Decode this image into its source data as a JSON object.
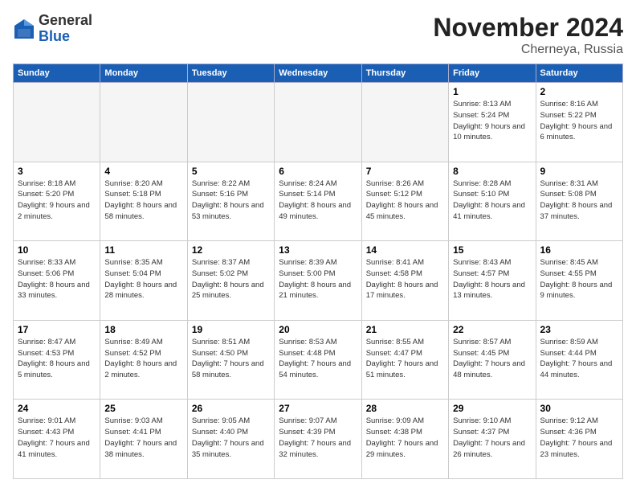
{
  "header": {
    "logo_general": "General",
    "logo_blue": "Blue",
    "month": "November 2024",
    "location": "Cherneya, Russia"
  },
  "days_of_week": [
    "Sunday",
    "Monday",
    "Tuesday",
    "Wednesday",
    "Thursday",
    "Friday",
    "Saturday"
  ],
  "weeks": [
    [
      {
        "day": "",
        "info": ""
      },
      {
        "day": "",
        "info": ""
      },
      {
        "day": "",
        "info": ""
      },
      {
        "day": "",
        "info": ""
      },
      {
        "day": "",
        "info": ""
      },
      {
        "day": "1",
        "info": "Sunrise: 8:13 AM\nSunset: 5:24 PM\nDaylight: 9 hours\nand 10 minutes."
      },
      {
        "day": "2",
        "info": "Sunrise: 8:16 AM\nSunset: 5:22 PM\nDaylight: 9 hours\nand 6 minutes."
      }
    ],
    [
      {
        "day": "3",
        "info": "Sunrise: 8:18 AM\nSunset: 5:20 PM\nDaylight: 9 hours\nand 2 minutes."
      },
      {
        "day": "4",
        "info": "Sunrise: 8:20 AM\nSunset: 5:18 PM\nDaylight: 8 hours\nand 58 minutes."
      },
      {
        "day": "5",
        "info": "Sunrise: 8:22 AM\nSunset: 5:16 PM\nDaylight: 8 hours\nand 53 minutes."
      },
      {
        "day": "6",
        "info": "Sunrise: 8:24 AM\nSunset: 5:14 PM\nDaylight: 8 hours\nand 49 minutes."
      },
      {
        "day": "7",
        "info": "Sunrise: 8:26 AM\nSunset: 5:12 PM\nDaylight: 8 hours\nand 45 minutes."
      },
      {
        "day": "8",
        "info": "Sunrise: 8:28 AM\nSunset: 5:10 PM\nDaylight: 8 hours\nand 41 minutes."
      },
      {
        "day": "9",
        "info": "Sunrise: 8:31 AM\nSunset: 5:08 PM\nDaylight: 8 hours\nand 37 minutes."
      }
    ],
    [
      {
        "day": "10",
        "info": "Sunrise: 8:33 AM\nSunset: 5:06 PM\nDaylight: 8 hours\nand 33 minutes."
      },
      {
        "day": "11",
        "info": "Sunrise: 8:35 AM\nSunset: 5:04 PM\nDaylight: 8 hours\nand 28 minutes."
      },
      {
        "day": "12",
        "info": "Sunrise: 8:37 AM\nSunset: 5:02 PM\nDaylight: 8 hours\nand 25 minutes."
      },
      {
        "day": "13",
        "info": "Sunrise: 8:39 AM\nSunset: 5:00 PM\nDaylight: 8 hours\nand 21 minutes."
      },
      {
        "day": "14",
        "info": "Sunrise: 8:41 AM\nSunset: 4:58 PM\nDaylight: 8 hours\nand 17 minutes."
      },
      {
        "day": "15",
        "info": "Sunrise: 8:43 AM\nSunset: 4:57 PM\nDaylight: 8 hours\nand 13 minutes."
      },
      {
        "day": "16",
        "info": "Sunrise: 8:45 AM\nSunset: 4:55 PM\nDaylight: 8 hours\nand 9 minutes."
      }
    ],
    [
      {
        "day": "17",
        "info": "Sunrise: 8:47 AM\nSunset: 4:53 PM\nDaylight: 8 hours\nand 5 minutes."
      },
      {
        "day": "18",
        "info": "Sunrise: 8:49 AM\nSunset: 4:52 PM\nDaylight: 8 hours\nand 2 minutes."
      },
      {
        "day": "19",
        "info": "Sunrise: 8:51 AM\nSunset: 4:50 PM\nDaylight: 7 hours\nand 58 minutes."
      },
      {
        "day": "20",
        "info": "Sunrise: 8:53 AM\nSunset: 4:48 PM\nDaylight: 7 hours\nand 54 minutes."
      },
      {
        "day": "21",
        "info": "Sunrise: 8:55 AM\nSunset: 4:47 PM\nDaylight: 7 hours\nand 51 minutes."
      },
      {
        "day": "22",
        "info": "Sunrise: 8:57 AM\nSunset: 4:45 PM\nDaylight: 7 hours\nand 48 minutes."
      },
      {
        "day": "23",
        "info": "Sunrise: 8:59 AM\nSunset: 4:44 PM\nDaylight: 7 hours\nand 44 minutes."
      }
    ],
    [
      {
        "day": "24",
        "info": "Sunrise: 9:01 AM\nSunset: 4:43 PM\nDaylight: 7 hours\nand 41 minutes."
      },
      {
        "day": "25",
        "info": "Sunrise: 9:03 AM\nSunset: 4:41 PM\nDaylight: 7 hours\nand 38 minutes."
      },
      {
        "day": "26",
        "info": "Sunrise: 9:05 AM\nSunset: 4:40 PM\nDaylight: 7 hours\nand 35 minutes."
      },
      {
        "day": "27",
        "info": "Sunrise: 9:07 AM\nSunset: 4:39 PM\nDaylight: 7 hours\nand 32 minutes."
      },
      {
        "day": "28",
        "info": "Sunrise: 9:09 AM\nSunset: 4:38 PM\nDaylight: 7 hours\nand 29 minutes."
      },
      {
        "day": "29",
        "info": "Sunrise: 9:10 AM\nSunset: 4:37 PM\nDaylight: 7 hours\nand 26 minutes."
      },
      {
        "day": "30",
        "info": "Sunrise: 9:12 AM\nSunset: 4:36 PM\nDaylight: 7 hours\nand 23 minutes."
      }
    ]
  ]
}
